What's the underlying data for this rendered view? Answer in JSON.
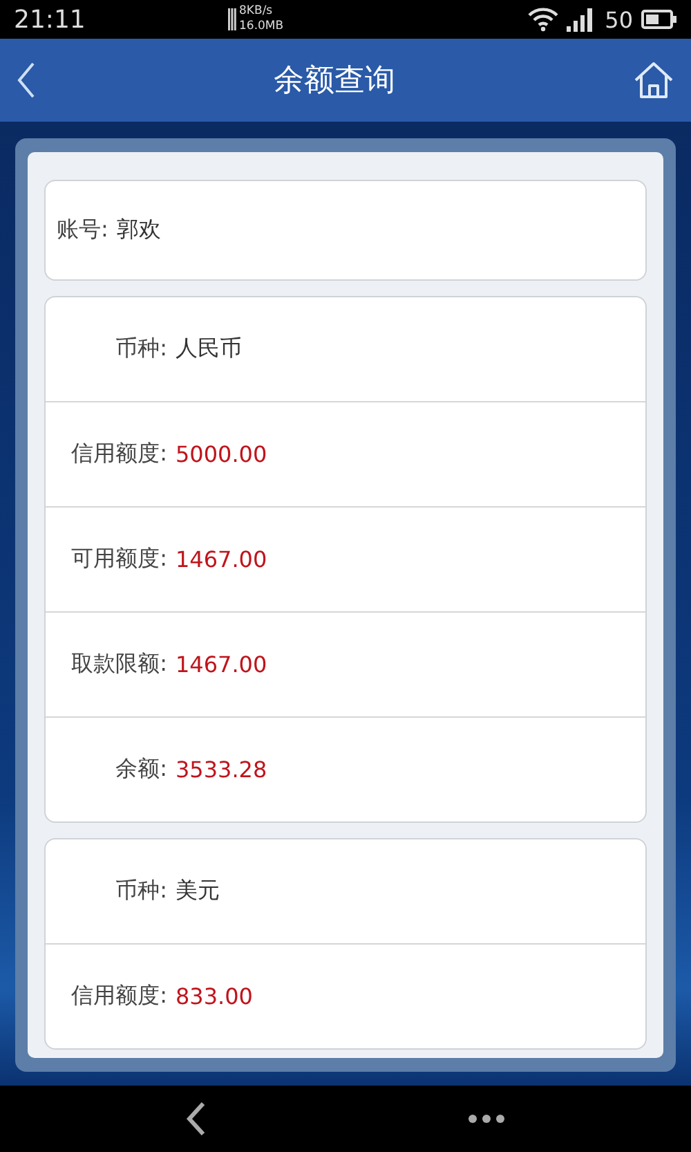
{
  "status_bar": {
    "time": "21:11",
    "speed": "8KB/s",
    "data": "16.0MB",
    "battery": "50"
  },
  "header": {
    "title": "余额查询"
  },
  "account": {
    "label": "账号:",
    "value": "郭欢"
  },
  "currencies": [
    {
      "fields": [
        {
          "kind": "currency",
          "label": "币种:",
          "value": "人民币"
        },
        {
          "kind": "amount",
          "label": "信用额度:",
          "value": "5000.00"
        },
        {
          "kind": "amount",
          "label": "可用额度:",
          "value": "1467.00"
        },
        {
          "kind": "amount",
          "label": "取款限额:",
          "value": "1467.00"
        },
        {
          "kind": "amount",
          "label": "余额:",
          "value": "3533.28"
        }
      ]
    },
    {
      "fields": [
        {
          "kind": "currency",
          "label": "币种:",
          "value": "美元"
        },
        {
          "kind": "amount",
          "label": "信用额度:",
          "value": "833.00"
        }
      ]
    }
  ]
}
